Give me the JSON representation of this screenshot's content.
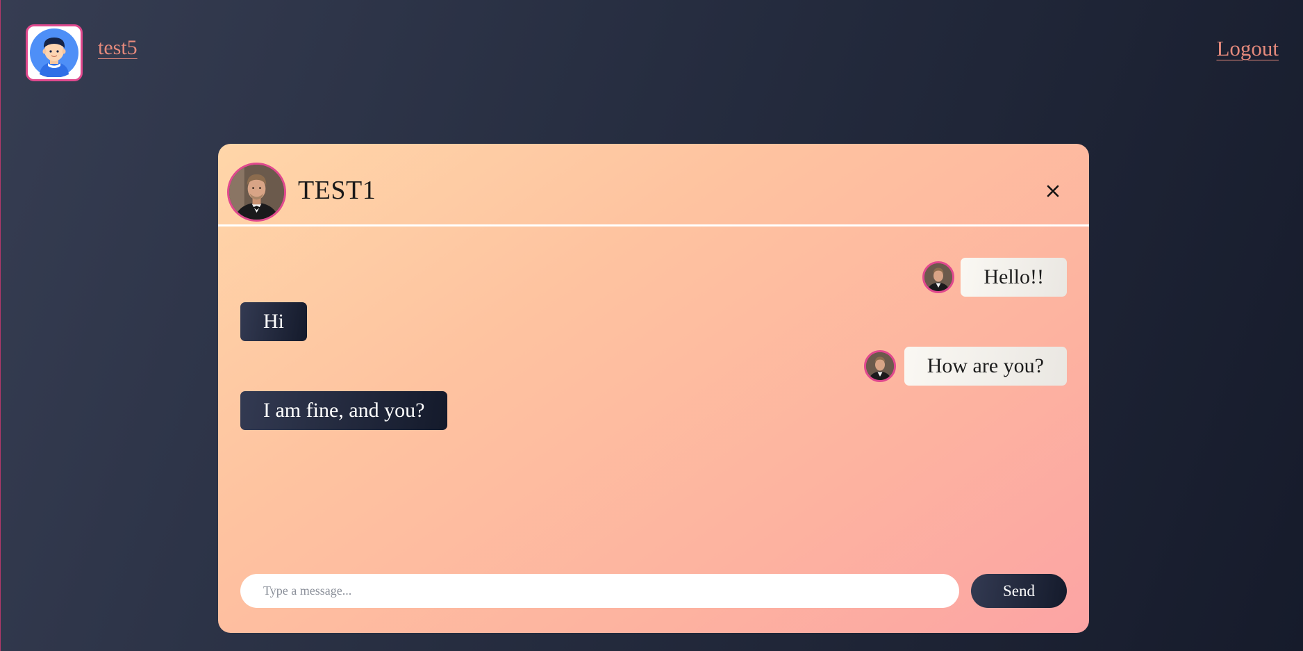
{
  "topbar": {
    "username": "test5",
    "logout_label": "Logout",
    "avatar_icon": "user-avatar-icon"
  },
  "chat": {
    "contact_name": "TEST1",
    "close_icon": "close-icon",
    "messages": [
      {
        "direction": "sent",
        "text": "Hello!!"
      },
      {
        "direction": "received",
        "text": "Hi"
      },
      {
        "direction": "sent",
        "text": "How are you?"
      },
      {
        "direction": "received",
        "text": "I am fine, and you?"
      }
    ],
    "input": {
      "placeholder": "Type a message...",
      "value": ""
    },
    "send_label": "Send"
  },
  "colors": {
    "accent_pink": "#e0498e",
    "link": "#e58a7c",
    "dark_button": "#1c2236"
  }
}
